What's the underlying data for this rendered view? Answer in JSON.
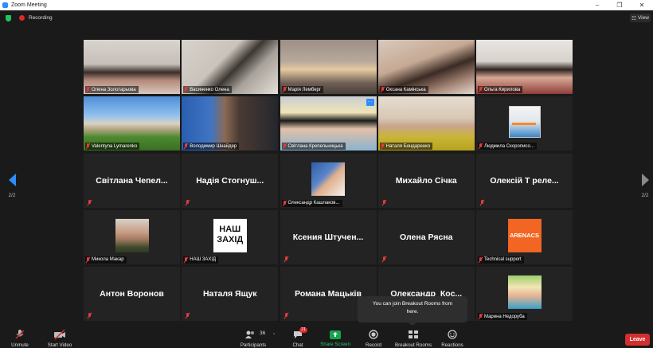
{
  "window": {
    "title": "Zoom Meeting",
    "controls": [
      "–",
      "❐",
      "✕"
    ]
  },
  "status": {
    "recording_label": "Recording",
    "view_label": "View"
  },
  "pager": {
    "left_page": "2/2",
    "right_page": "2/2"
  },
  "tiles": [
    {
      "name": "Олена Золотарьова",
      "kind": "video",
      "muted": true
    },
    {
      "name": "Васиненко Олена",
      "kind": "video",
      "muted": true
    },
    {
      "name": "Марія Лемберг",
      "kind": "video",
      "muted": true,
      "active_speaker": true
    },
    {
      "name": "Оксана Камінська",
      "kind": "video",
      "muted": true
    },
    {
      "name": "Ольга Кирилова",
      "kind": "video",
      "muted": true
    },
    {
      "name": "Valentyna Lymarenko",
      "kind": "video",
      "muted": true
    },
    {
      "name": "Володимир Шнайдер",
      "kind": "video",
      "muted": true
    },
    {
      "name": "Світлана Крепельницька",
      "kind": "video",
      "muted": true
    },
    {
      "name": "Наталя Бондаренко",
      "kind": "video",
      "muted": true
    },
    {
      "name": "Людмила Скорописо...",
      "kind": "video",
      "muted": true
    },
    {
      "name": "Світлана  Чепел...",
      "kind": "name",
      "muted": true
    },
    {
      "name": "Надія Стогнуш...",
      "kind": "name",
      "muted": true
    },
    {
      "name": "Олександр Кашлаков...",
      "kind": "avatar",
      "muted": true
    },
    {
      "name": "Михайло Січка",
      "kind": "name",
      "muted": true
    },
    {
      "name": "Олексій Т реле...",
      "kind": "name",
      "muted": true
    },
    {
      "name": "Микола Макар",
      "kind": "avatar",
      "muted": true
    },
    {
      "name": "НАШ ЗАХІД",
      "kind": "avatar",
      "muted": true,
      "logo_text": [
        "НАШ",
        "ЗАХІД"
      ]
    },
    {
      "name": "Ксения  Штучен...",
      "kind": "name",
      "muted": true
    },
    {
      "name": "Олена Рясна",
      "kind": "name",
      "muted": true
    },
    {
      "name": "Technical support",
      "kind": "avatar",
      "muted": true,
      "logo_text": [
        "ARENACS"
      ]
    },
    {
      "name": "Антон Воронов",
      "kind": "name",
      "muted": true
    },
    {
      "name": "Наталя Ящук",
      "kind": "name",
      "muted": true
    },
    {
      "name": "Романа Мацьків",
      "kind": "name",
      "muted": true
    },
    {
      "name": "Олександр_Кос...",
      "kind": "name",
      "muted": true
    },
    {
      "name": "Марина Недоруба",
      "kind": "avatar",
      "muted": true
    }
  ],
  "toast": {
    "text_line1": "You can join Breakout Rooms from",
    "text_line2": "here."
  },
  "toolbar": {
    "unmute": "Unmute",
    "start_video": "Start Video",
    "participants": "Participants",
    "participants_count": "36",
    "chat": "Chat",
    "chat_badge": "21",
    "share_screen": "Share Screen",
    "record": "Record",
    "breakout_rooms": "Breakout Rooms",
    "reactions": "Reactions",
    "leave": "Leave"
  },
  "colors": {
    "active_speaker": "#b9e65a",
    "accent": "#2d8cff",
    "share_green": "#16a34a",
    "leave_red": "#d32f2f"
  }
}
